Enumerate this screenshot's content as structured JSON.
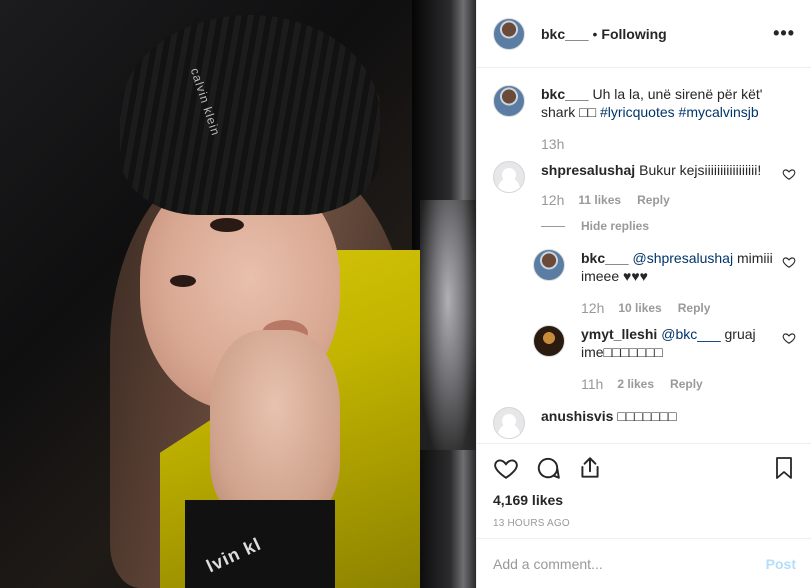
{
  "post": {
    "username": "bkc___",
    "separator": "•",
    "follow_status": "Following",
    "more_icon": "more-dots-icon"
  },
  "photo": {
    "beanie_text": "calvin klein",
    "cuff_text": "lvin kl"
  },
  "caption": {
    "username": "bkc___",
    "text": "Uh la la, unë sirenë për kët' shark",
    "emoji_placeholder": "□□",
    "hashtag1": "#lyricquotes",
    "hashtag2": "#mycalvinsjb",
    "time": "13h"
  },
  "comments": [
    {
      "username": "shpresalushaj",
      "text": "Bukur kejsiiiiiiiiiiiiiiiii!",
      "time": "12h",
      "likes": "11 likes",
      "reply": "Reply",
      "hide_replies": "Hide replies"
    }
  ],
  "replies": [
    {
      "username": "bkc___",
      "mention": "@shpresalushaj",
      "text": "mimiii imeee ♥♥♥",
      "time": "12h",
      "likes": "10 likes",
      "reply": "Reply"
    },
    {
      "username": "ymyt_lleshi",
      "mention": "@bkc___",
      "text": "gruaj ime□□□□□□□",
      "time": "11h",
      "likes": "2 likes",
      "reply": "Reply"
    }
  ],
  "next_comment_partial": {
    "username": "anushisvis",
    "text": "□□□□□□□"
  },
  "actions": {
    "icons": [
      "heart-icon",
      "comment-icon",
      "share-icon",
      "bookmark-icon"
    ],
    "likes_count": "4,169 likes",
    "post_time": "13 HOURS AGO"
  },
  "add_comment": {
    "placeholder": "Add a comment...",
    "post_label": "Post"
  },
  "colors": {
    "link": "#003569",
    "muted": "#999999",
    "post_disabled": "#b2dffc",
    "border": "#efefef"
  }
}
